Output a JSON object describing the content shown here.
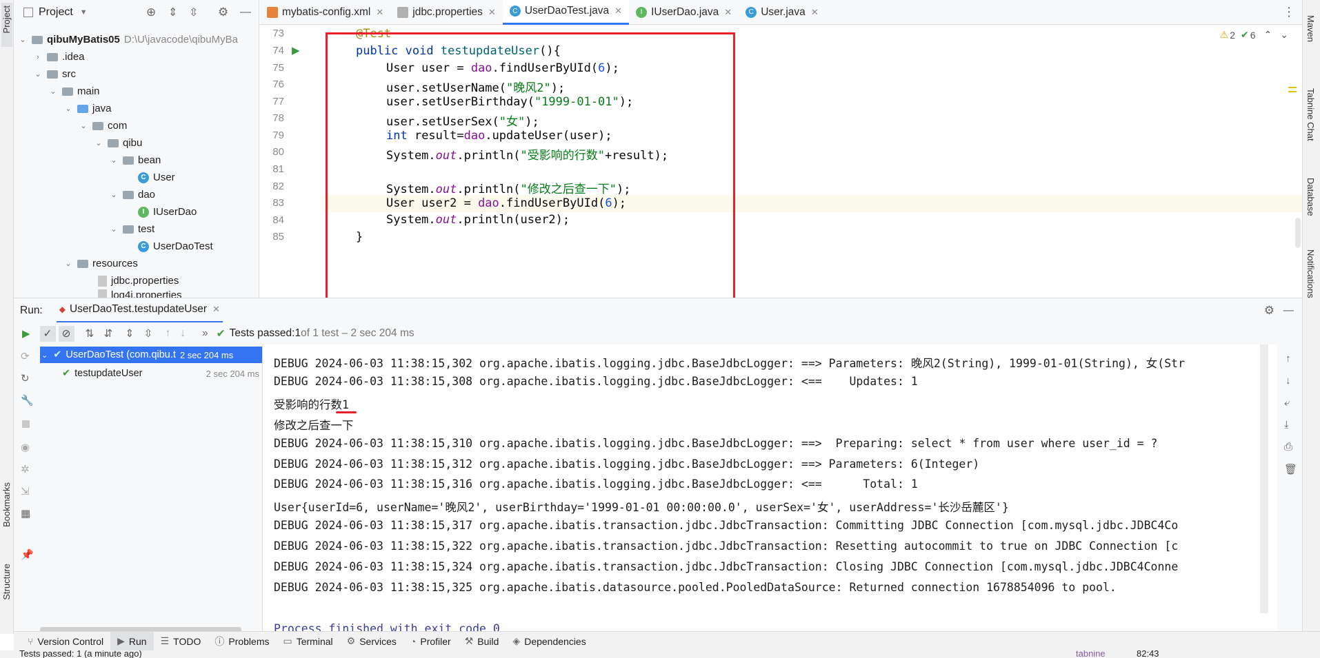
{
  "left_strip": {
    "project": "Project",
    "bookmarks": "Bookmarks",
    "structure": "Structure"
  },
  "right_strip": {
    "maven": "Maven",
    "tabnine": "Tabnine Chat",
    "database": "Database",
    "notifications": "Notifications"
  },
  "project_panel": {
    "title": "Project",
    "tree": [
      {
        "label": "qibuMyBatis05",
        "hint": "D:\\U\\javacode\\qibuMyBa"
      },
      {
        "label": ".idea"
      },
      {
        "label": "src"
      },
      {
        "label": "main"
      },
      {
        "label": "java"
      },
      {
        "label": "com"
      },
      {
        "label": "qibu"
      },
      {
        "label": "bean"
      },
      {
        "label": "User"
      },
      {
        "label": "dao"
      },
      {
        "label": "IUserDao"
      },
      {
        "label": "test"
      },
      {
        "label": "UserDaoTest"
      },
      {
        "label": "resources"
      },
      {
        "label": "jdbc.properties"
      },
      {
        "label": "log4j.properties"
      }
    ]
  },
  "tabs": [
    {
      "label": "mybatis-config.xml"
    },
    {
      "label": "jdbc.properties"
    },
    {
      "label": "UserDaoTest.java"
    },
    {
      "label": "IUserDao.java"
    },
    {
      "label": "User.java"
    }
  ],
  "editor": {
    "warnings": "2",
    "checks": "6",
    "line_numbers": [
      "73",
      "74",
      "75",
      "76",
      "77",
      "78",
      "79",
      "80",
      "81",
      "82",
      "83",
      "84",
      "85"
    ],
    "lines": {
      "l73": "@Test",
      "l74_kw": "public void ",
      "l74_fn": "testupdateUser",
      "l74_rest": "(){",
      "l75_a": "User user = ",
      "l75_dao": "dao",
      "l75_b": ".findUserByUId(",
      "l75_num": "6",
      "l75_c": ");",
      "l76_a": "user.setUserName(",
      "l76_str": "\"晚风2\"",
      "l76_c": ");",
      "l77_a": "user.setUserBirthday(",
      "l77_str": "\"1999-01-01\"",
      "l77_c": ");",
      "l78_a": "user.setUserSex(",
      "l78_str": "\"女\"",
      "l78_c": ");",
      "l79_kw": "int ",
      "l79_a": "result=",
      "l79_dao": "dao",
      "l79_b": ".updateUser(user);",
      "l80_a": "System.",
      "l80_out": "out",
      "l80_b": ".println(",
      "l80_str": "\"受影响的行数\"",
      "l80_c": "+result);",
      "l82_a": "System.",
      "l82_out": "out",
      "l82_b": ".println(",
      "l82_str": "\"修改之后查一下\"",
      "l82_c": ");",
      "l83_a": "User user2 = ",
      "l83_dao": "dao",
      "l83_b": ".findUserByUId(",
      "l83_num": "6",
      "l83_c": ");",
      "l84_a": "System.",
      "l84_out": "out",
      "l84_b": ".println(user2);",
      "l85": "}"
    }
  },
  "run": {
    "label": "Run:",
    "config": "UserDaoTest.testupdateUser",
    "status_prefix": "Tests passed: ",
    "status_count": "1",
    "status_suffix": " of 1 test – 2 sec 204 ms",
    "tree": [
      {
        "label": "UserDaoTest (com.qibu.t",
        "time": "2 sec 204 ms"
      },
      {
        "label": "testupdateUser",
        "time": "2 sec 204 ms"
      }
    ],
    "console": [
      "DEBUG 2024-06-03 11:38:15,302 org.apache.ibatis.logging.jdbc.BaseJdbcLogger: ==> Parameters: 晚风2(String), 1999-01-01(String), 女(Str",
      "DEBUG 2024-06-03 11:38:15,308 org.apache.ibatis.logging.jdbc.BaseJdbcLogger: <==    Updates: 1",
      "受影响的行数1",
      "修改之后查一下",
      "DEBUG 2024-06-03 11:38:15,310 org.apache.ibatis.logging.jdbc.BaseJdbcLogger: ==>  Preparing: select * from user where user_id = ?",
      "DEBUG 2024-06-03 11:38:15,312 org.apache.ibatis.logging.jdbc.BaseJdbcLogger: ==> Parameters: 6(Integer)",
      "DEBUG 2024-06-03 11:38:15,316 org.apache.ibatis.logging.jdbc.BaseJdbcLogger: <==      Total: 1",
      "User{userId=6, userName='晚风2', userBirthday='1999-01-01 00:00:00.0', userSex='女', userAddress='长沙岳麓区'}",
      "DEBUG 2024-06-03 11:38:15,317 org.apache.ibatis.transaction.jdbc.JdbcTransaction: Committing JDBC Connection [com.mysql.jdbc.JDBC4Co",
      "DEBUG 2024-06-03 11:38:15,322 org.apache.ibatis.transaction.jdbc.JdbcTransaction: Resetting autocommit to true on JDBC Connection [c",
      "DEBUG 2024-06-03 11:38:15,324 org.apache.ibatis.transaction.jdbc.JdbcTransaction: Closing JDBC Connection [com.mysql.jdbc.JDBC4Conne",
      "DEBUG 2024-06-03 11:38:15,325 org.apache.ibatis.datasource.pooled.PooledDataSource: Returned connection 1678854096 to pool.",
      "Process finished with exit code 0"
    ]
  },
  "toolwindows": [
    "Version Control",
    "Run",
    "TODO",
    "Problems",
    "Terminal",
    "Services",
    "Profiler",
    "Build",
    "Dependencies"
  ],
  "status": {
    "text": "Tests passed: 1 (a minute ago)",
    "time": "82:43",
    "tabnine": "tabnine"
  },
  "colors": {
    "accent": "#3574f0",
    "highlight_box": "#e8202a",
    "pass_green": "#3c9a3c"
  }
}
